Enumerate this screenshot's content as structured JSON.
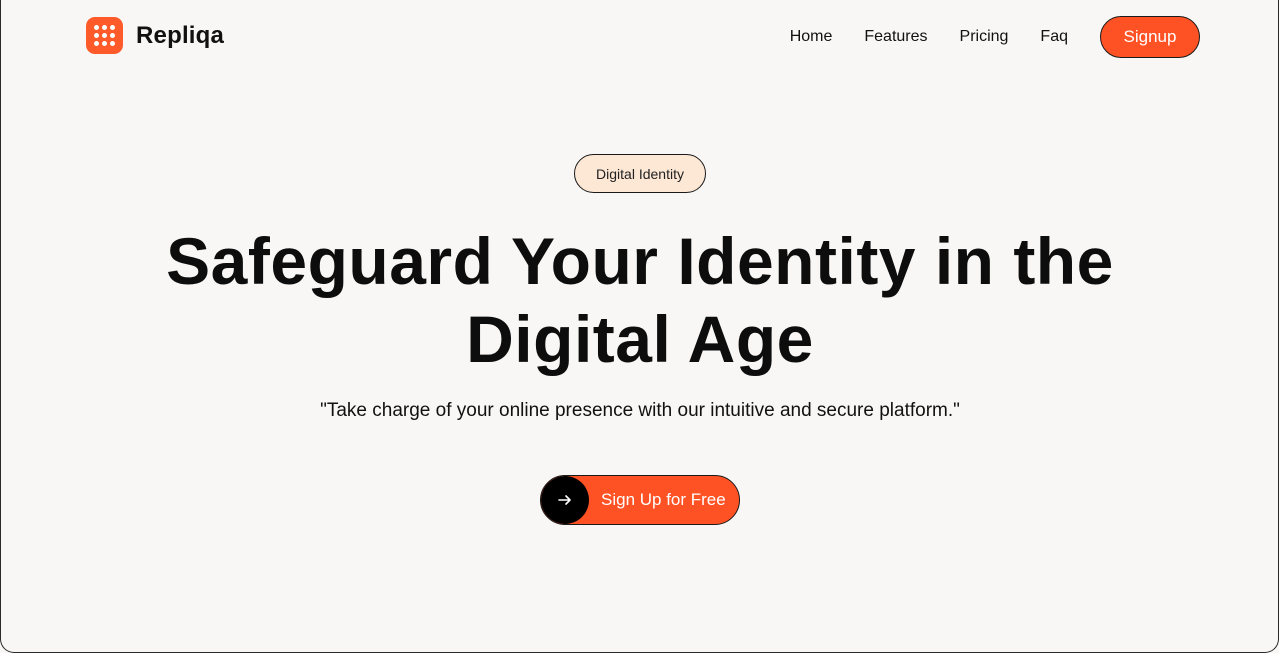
{
  "header": {
    "brand_name": "Repliqa",
    "nav": {
      "home": "Home",
      "features": "Features",
      "pricing": "Pricing",
      "faq": "Faq"
    },
    "signup_label": "Signup"
  },
  "hero": {
    "badge": "Digital Identity",
    "title_line1": "Safeguard Your Identity in the",
    "title_line2": "Digital Age",
    "subtitle": "\"Take charge of your online presence with our intuitive and secure platform.\"",
    "cta_label": "Sign Up for Free",
    "cta_icon": "arrow-right-icon"
  },
  "colors": {
    "background": "#f8f7f5",
    "accent": "#ff5224",
    "badge_bg": "#fde8d6",
    "text": "#111111"
  }
}
